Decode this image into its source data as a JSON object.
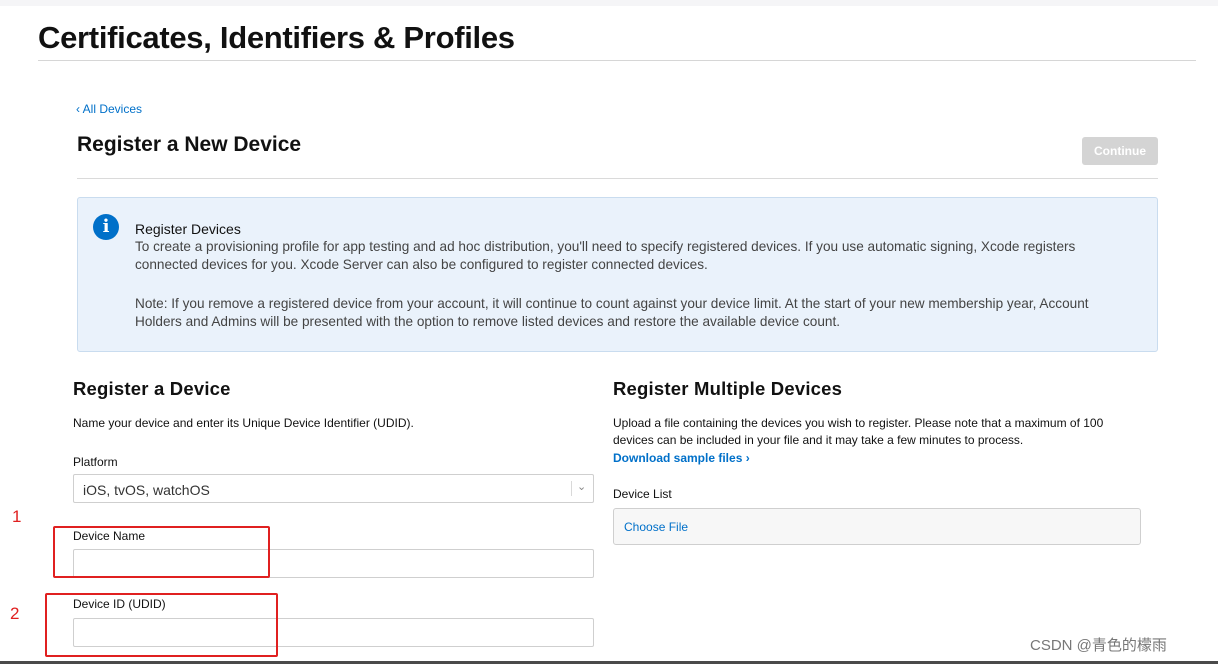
{
  "page": {
    "title": "Certificates, Identifiers & Profiles",
    "back_link": "‹ All Devices",
    "section_title": "Register a New Device",
    "continue_label": "Continue"
  },
  "info": {
    "icon": "info-icon",
    "heading": "Register Devices",
    "text": "To create a provisioning profile for app testing and ad hoc distribution, you'll need to specify registered devices. If you use automatic signing, Xcode registers connected devices for you. Xcode Server can also be configured to register connected devices.",
    "note": "Note: If you remove a registered device from your account, it will continue to count against your device limit. At the start of your new membership year, Account Holders and Admins will be presented with the option to remove listed devices and restore the available device count."
  },
  "single": {
    "title": "Register a Device",
    "description": "Name your device and enter its Unique Device Identifier (UDID).",
    "platform_label": "Platform",
    "platform_value": "iOS, tvOS, watchOS",
    "device_name_label": "Device Name",
    "device_name_value": "",
    "device_id_label": "Device ID (UDID)",
    "device_id_value": ""
  },
  "multiple": {
    "title": "Register Multiple Devices",
    "description": "Upload a file containing the devices you wish to register. Please note that a maximum of 100 devices can be included in your file and it may take a few minutes to process.",
    "download_link": "Download sample files ›",
    "device_list_label": "Device List",
    "choose_file": "Choose File"
  },
  "annotations": {
    "marker_1": "1",
    "marker_2": "2",
    "color": "#e02020"
  },
  "watermark": "CSDN @青色的檬雨",
  "colors": {
    "accent": "#0070c9",
    "info_background": "#eaf2fb",
    "button_disabled": "#d4d4d4"
  }
}
